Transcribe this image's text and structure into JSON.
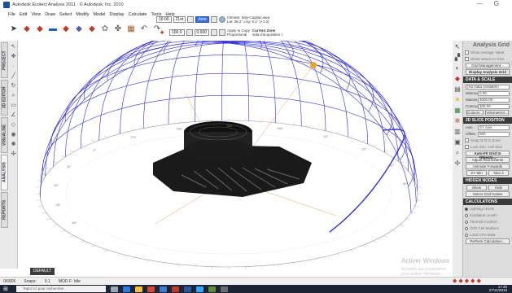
{
  "window": {
    "title": "Autodesk Ecotect Analysis 2011 · © Autodesk, Inc. 2010",
    "minimize_glyph": "—",
    "close_glyph": "G"
  },
  "menu": [
    "File",
    "Edit",
    "View",
    "Draw",
    "Select",
    "Modify",
    "Model",
    "Display",
    "Calculate",
    "Tools",
    "Help"
  ],
  "toolbar": {
    "time_value": "15:00",
    "date_value": "21st",
    "month_value": "June",
    "location_line1": "Climate: Italy-Cagliari.wea",
    "location_line2": "Lat: 39.2°   Lng: 9.1° (+1.0)",
    "apply_label": "Apply to Copy",
    "proportional_label": "Proportional",
    "zoom_value": "100.0",
    "angle_value": "0.000",
    "current_zone_label": "Current Zone",
    "current_zone_value": "sala d'acquisition c"
  },
  "left_tabs": [
    "PROJECT",
    "3D EDITOR",
    "VISUALISE",
    "ANALYSIS",
    "REPORTS"
  ],
  "viewport": {
    "default_tab": "DEFAULT",
    "watermark_title": "Activer Windows",
    "watermark_sub": "Accédez aux paramètres pour activer Windows.",
    "dome_labels": [
      "60°",
      "45°",
      "30°",
      "15°",
      "0°",
      "270",
      "230",
      "300",
      "340",
      "10°",
      "20°",
      "40°",
      "80°"
    ]
  },
  "panel": {
    "title": "Analysis Grid",
    "show_average": "Show Average Value",
    "show_values": "Show Values In Grid",
    "grid_management": "Grid Management...",
    "display_grid": "Display Analysis Grid",
    "data_scale_head": "DATA & SCALE",
    "no_data": "(No Data Available)",
    "min_label": "Minimum",
    "min_value": "0.00",
    "max_label": "Maximum",
    "max_value": "3000.00",
    "contours_label": "Contours",
    "contours_value": "300.00",
    "colours_btn": "Colours...",
    "volumetrics_btn": "Volumetrics...",
    "slice_head": "2D SLICE POSITION",
    "axis_label": "Axis",
    "axis_value": "XY Axis",
    "offset_label": "Offset",
    "offset_value": "500",
    "snap_label": "Snap Grid to Zone",
    "lock_label": "Lock Dim. Cell Size",
    "auto_fit_btn": "Auto-Fit Grid to Objects...",
    "adjust_btn": "Adjust Grid Extents",
    "animate_btn": "Animate Forwards",
    "xy_min_btn": "XY Min",
    "max_btn": "Max 3",
    "hidden_head": "HIDDEN NODES",
    "show_btn": "Show",
    "hide_btn": "Hide",
    "select_nodes_btn": "Select Grid Nodes",
    "calc_head": "CALCULATIONS",
    "calc_options": [
      "Lighting Levels",
      "Insolation Levels",
      "Thermal Comfort",
      "CFD Cell Markers",
      "Load CFD Data"
    ],
    "perform_btn": "Perform Calculation..."
  },
  "status": {
    "coords": "0/6805",
    "snaps": "Snaps:",
    "grid": "0.1",
    "mode": "MOD F: Idle"
  },
  "taskbar": {
    "search_placeholder": "Tapez ici pour rechercher",
    "time": "17:40",
    "date": "27/11/2019"
  },
  "colors": {
    "sun_path": "#2f2fd2",
    "accent_orange": "#f0a020",
    "panel_header": "#3a3a3a",
    "taskbar": "#1c2533"
  }
}
